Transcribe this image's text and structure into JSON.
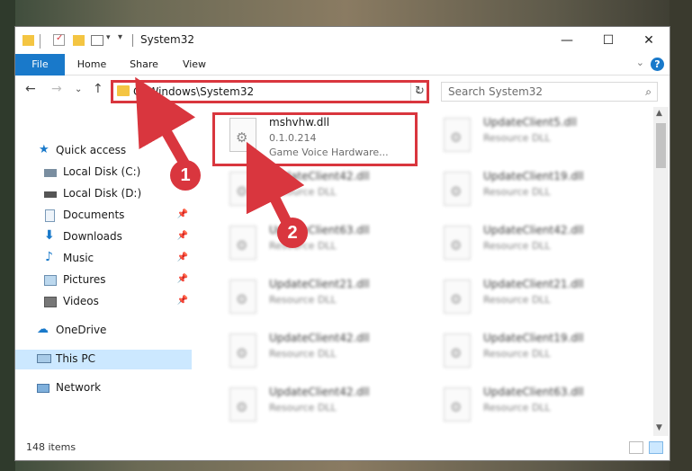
{
  "window": {
    "title": "System32",
    "controls": {
      "minimize": "—",
      "maximize": "☐",
      "close": "✕"
    }
  },
  "ribbon": {
    "tabs": [
      {
        "label": "File"
      },
      {
        "label": "Home"
      },
      {
        "label": "Share"
      },
      {
        "label": "View"
      }
    ],
    "help": "?"
  },
  "address": {
    "path": "C:\\Windows\\System32",
    "search_placeholder": "Search System32"
  },
  "nav": {
    "items": [
      {
        "label": "Quick access",
        "icon": "star-icon"
      },
      {
        "label": "Local Disk (C:)",
        "icon": "drive-icon"
      },
      {
        "label": "Local Disk (D:)",
        "icon": "drive-icon"
      },
      {
        "label": "Documents",
        "icon": "documents-icon"
      },
      {
        "label": "Downloads",
        "icon": "download-icon"
      },
      {
        "label": "Music",
        "icon": "music-icon"
      },
      {
        "label": "Pictures",
        "icon": "pictures-icon"
      },
      {
        "label": "Videos",
        "icon": "videos-icon"
      },
      {
        "label": "OneDrive",
        "icon": "cloud-icon"
      },
      {
        "label": "This PC",
        "icon": "computer-icon"
      },
      {
        "label": "Network",
        "icon": "network-icon"
      }
    ]
  },
  "files": {
    "highlighted": {
      "name": "mshvhw.dll",
      "version": "0.1.0.214",
      "description": "Game Voice Hardware..."
    },
    "left_column": [
      {
        "name": "UpdateClient42.dll",
        "type": "Resource DLL"
      },
      {
        "name": "UpdateClient63.dll",
        "type": "Resource DLL"
      },
      {
        "name": "UpdateClient21.dll",
        "type": "Resource DLL"
      },
      {
        "name": "UpdateClient42.dll",
        "type": "Resource DLL"
      },
      {
        "name": "UpdateClient42.dll",
        "type": "Resource DLL"
      }
    ],
    "right_column": [
      {
        "name": "UpdateClient5.dll",
        "type": "Resource DLL"
      },
      {
        "name": "UpdateClient19.dll",
        "type": "Resource DLL"
      },
      {
        "name": "UpdateClient42.dll",
        "type": "Resource DLL"
      },
      {
        "name": "UpdateClient21.dll",
        "type": "Resource DLL"
      },
      {
        "name": "UpdateClient19.dll",
        "type": "Resource DLL"
      },
      {
        "name": "UpdateClient63.dll",
        "type": "Resource DLL"
      }
    ]
  },
  "status": {
    "item_count": "148 items"
  },
  "annotations": {
    "step1": "1",
    "step2": "2",
    "highlight_color": "#d9363e"
  },
  "colors": {
    "accent": "#1979ca",
    "selection": "#cce8ff"
  }
}
